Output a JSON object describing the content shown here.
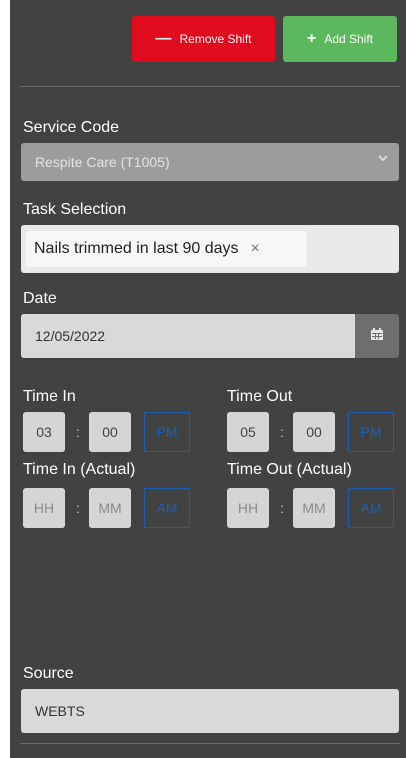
{
  "actions": {
    "remove_label": "Remove Shift",
    "add_label": "Add Shift"
  },
  "service_code": {
    "label": "Service Code",
    "value": "Respite Care (T1005)"
  },
  "task_selection": {
    "label": "Task Selection",
    "tag": "Nails trimmed in last 90 days",
    "remove_symbol": "×"
  },
  "date": {
    "label": "Date",
    "value": "12/05/2022"
  },
  "time_in": {
    "label": "Time In",
    "hour": "03",
    "minute": "00",
    "meridiem": "PM"
  },
  "time_out": {
    "label": "Time Out",
    "hour": "05",
    "minute": "00",
    "meridiem": "PM"
  },
  "time_in_actual": {
    "label": "Time In (Actual)",
    "hour_placeholder": "HH",
    "minute_placeholder": "MM",
    "meridiem": "AM"
  },
  "time_out_actual": {
    "label": "Time Out (Actual)",
    "hour_placeholder": "HH",
    "minute_placeholder": "MM",
    "meridiem": "AM"
  },
  "source": {
    "label": "Source",
    "value": "WEBTS"
  },
  "colors": {
    "panel_bg": "#424242",
    "remove_red": "#e00b1c",
    "add_green": "#5cb85c",
    "accent_blue": "#1b5fb4"
  }
}
